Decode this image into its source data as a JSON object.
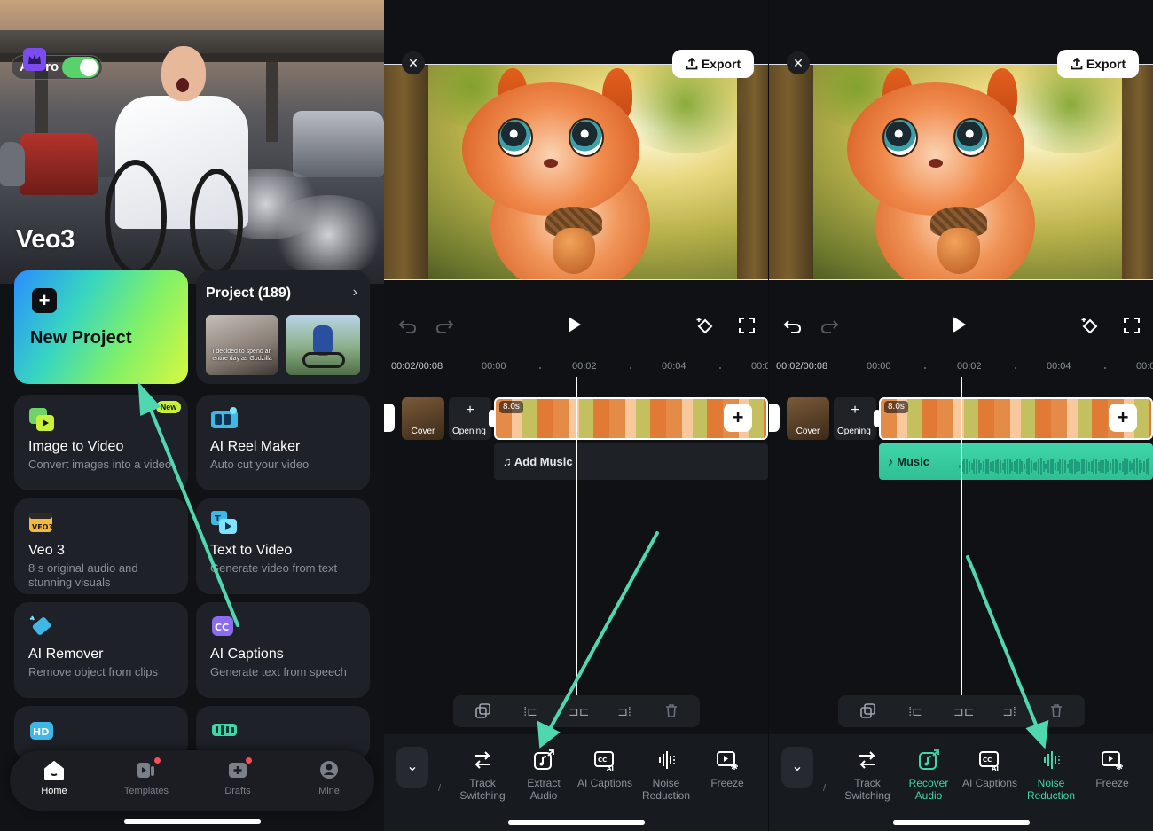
{
  "home": {
    "pro_label": "AI Pro",
    "banner_title": "Veo3",
    "new_project_label": "New Project",
    "project_card": {
      "title": "Project (189)",
      "thumb1_caption": "I decided to spend an entire day as Godzilla"
    },
    "new_badge": "New",
    "tools": [
      {
        "name": "Image to Video",
        "desc": "Convert images into a video",
        "icon": "image-to-video-icon"
      },
      {
        "name": "AI Reel Maker",
        "desc": "Auto cut your video",
        "icon": "reel-maker-icon"
      },
      {
        "name": "Veo 3",
        "desc": "8 s original audio and stunning visuals",
        "icon": "veo3-icon"
      },
      {
        "name": "Text to Video",
        "desc": "Generate video from text",
        "icon": "text-to-video-icon"
      },
      {
        "name": "AI Remover",
        "desc": "Remove object from clips",
        "icon": "eraser-icon"
      },
      {
        "name": "AI Captions",
        "desc": "Generate text from speech",
        "icon": "cc-icon"
      }
    ],
    "tabs": [
      {
        "label": "Home",
        "icon": "home-icon"
      },
      {
        "label": "Templates",
        "icon": "templates-icon"
      },
      {
        "label": "Drafts",
        "icon": "drafts-icon"
      },
      {
        "label": "Mine",
        "icon": "profile-icon"
      }
    ]
  },
  "editor_left": {
    "export_label": "Export",
    "timecode": "00:02/00:08",
    "ticks": [
      "00:00",
      "00:02",
      "00:04",
      "00:0"
    ],
    "cover_label": "Cover",
    "opening_label": "Opening",
    "clip_duration": "8.0s",
    "music_label": "Add Music",
    "toolbar": [
      {
        "label": "Track Switching",
        "icon": "track-switching-icon"
      },
      {
        "label": "Extract Audio",
        "icon": "extract-audio-icon"
      },
      {
        "label": "AI Captions",
        "icon": "ai-captions-icon"
      },
      {
        "label": "Noise Reduction",
        "icon": "noise-reduction-icon"
      },
      {
        "label": "Freeze",
        "icon": "freeze-icon"
      }
    ]
  },
  "editor_right": {
    "export_label": "Export",
    "timecode": "00:02/00:08",
    "ticks": [
      "00:00",
      "00:02",
      "00:04",
      "00:0"
    ],
    "cover_label": "Cover",
    "opening_label": "Opening",
    "clip_duration": "8.0s",
    "music_label": "Music",
    "toolbar": [
      {
        "label": "Track Switching",
        "icon": "track-switching-icon"
      },
      {
        "label": "Recover Audio",
        "icon": "recover-audio-icon"
      },
      {
        "label": "AI Captions",
        "icon": "ai-captions-icon"
      },
      {
        "label": "Noise Reduction",
        "icon": "noise-reduction-icon"
      },
      {
        "label": "Freeze",
        "icon": "freeze-icon"
      }
    ]
  },
  "colors": {
    "accent": "#3fd6a9",
    "arrow": "#4fd8b0",
    "new_badge": "#c8f23a",
    "bg": "#0f1114"
  }
}
